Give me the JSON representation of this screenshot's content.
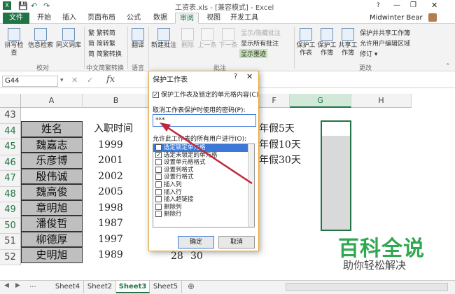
{
  "window": {
    "title": "工资表.xls - [兼容模式] - Excel",
    "user": "Midwinter Bear"
  },
  "tabs": [
    "文件",
    "开始",
    "插入",
    "页面布局",
    "公式",
    "数据",
    "审阅",
    "视图",
    "开发工具"
  ],
  "ribbon": {
    "proofing": {
      "label": "校对",
      "items": [
        "拼写检查",
        "信息检索",
        "同义词库"
      ]
    },
    "chinese": {
      "label": "中文简繁转换",
      "items": [
        "繁转简",
        "简转繁",
        "简繁转换"
      ]
    },
    "language": {
      "label": "语言",
      "items": [
        "翻译"
      ]
    },
    "comments": {
      "label": "批注",
      "items": [
        "新建批注",
        "删除",
        "上一条",
        "下一条"
      ],
      "side": [
        "显示/隐藏批注",
        "显示所有批注",
        "显示墨迹"
      ]
    },
    "changes": {
      "label": "更改",
      "items": [
        "保护工作表",
        "保护工作簿",
        "共享工作簿"
      ],
      "side": [
        "保护并共享工作簿",
        "允许用户编辑区域",
        "修订"
      ]
    }
  },
  "formula_bar": {
    "name_box": "G44",
    "fx": "fx"
  },
  "columns": [
    "A",
    "B",
    "C",
    "D",
    "E",
    "F",
    "G",
    "H"
  ],
  "rows": [
    "43",
    "44",
    "45",
    "46",
    "47",
    "48",
    "49",
    "50",
    "51",
    "52"
  ],
  "names": [
    "姓名",
    "魏嘉志",
    "乐彦博",
    "殷伟诚",
    "魏高俊",
    "章明旭",
    "潘俊哲",
    "柳德厚",
    "史明旭"
  ],
  "years": [
    "入职时间",
    "1999",
    "2001",
    "2002",
    "2005",
    "1998",
    "1987",
    "1997",
    "1989"
  ],
  "e_texts": [
    "年假5天",
    "年假10天",
    "年假30天"
  ],
  "partial": [
    "28",
    "30"
  ],
  "sheets": [
    "Sheet4",
    "Sheet2",
    "Sheet3",
    "Sheet5"
  ],
  "dialog": {
    "title": "保护工作表",
    "protect_check": "保护工作表及锁定的单元格内容(C)",
    "password_label": "取消工作表保护时使用的密码(P):",
    "password_value": "***",
    "allow_label": "允许此工作表的所有用户进行(O):",
    "permissions": [
      {
        "label": "选定锁定单元格",
        "checked": true,
        "selected": true
      },
      {
        "label": "选定未锁定的单元格",
        "checked": true,
        "selected": false
      },
      {
        "label": "设置单元格格式",
        "checked": false,
        "selected": false
      },
      {
        "label": "设置列格式",
        "checked": false,
        "selected": false
      },
      {
        "label": "设置行格式",
        "checked": false,
        "selected": false
      },
      {
        "label": "插入列",
        "checked": false,
        "selected": false
      },
      {
        "label": "插入行",
        "checked": false,
        "selected": false
      },
      {
        "label": "插入超链接",
        "checked": false,
        "selected": false
      },
      {
        "label": "删除列",
        "checked": false,
        "selected": false
      },
      {
        "label": "删除行",
        "checked": false,
        "selected": false
      }
    ],
    "ok": "确定",
    "cancel": "取消"
  },
  "watermark": {
    "main": "百科全说",
    "sub": "助你轻松解决"
  },
  "colors": {
    "excel_green": "#217346",
    "dialog_border": "#e4a93a",
    "arrow": "#c0283a"
  }
}
